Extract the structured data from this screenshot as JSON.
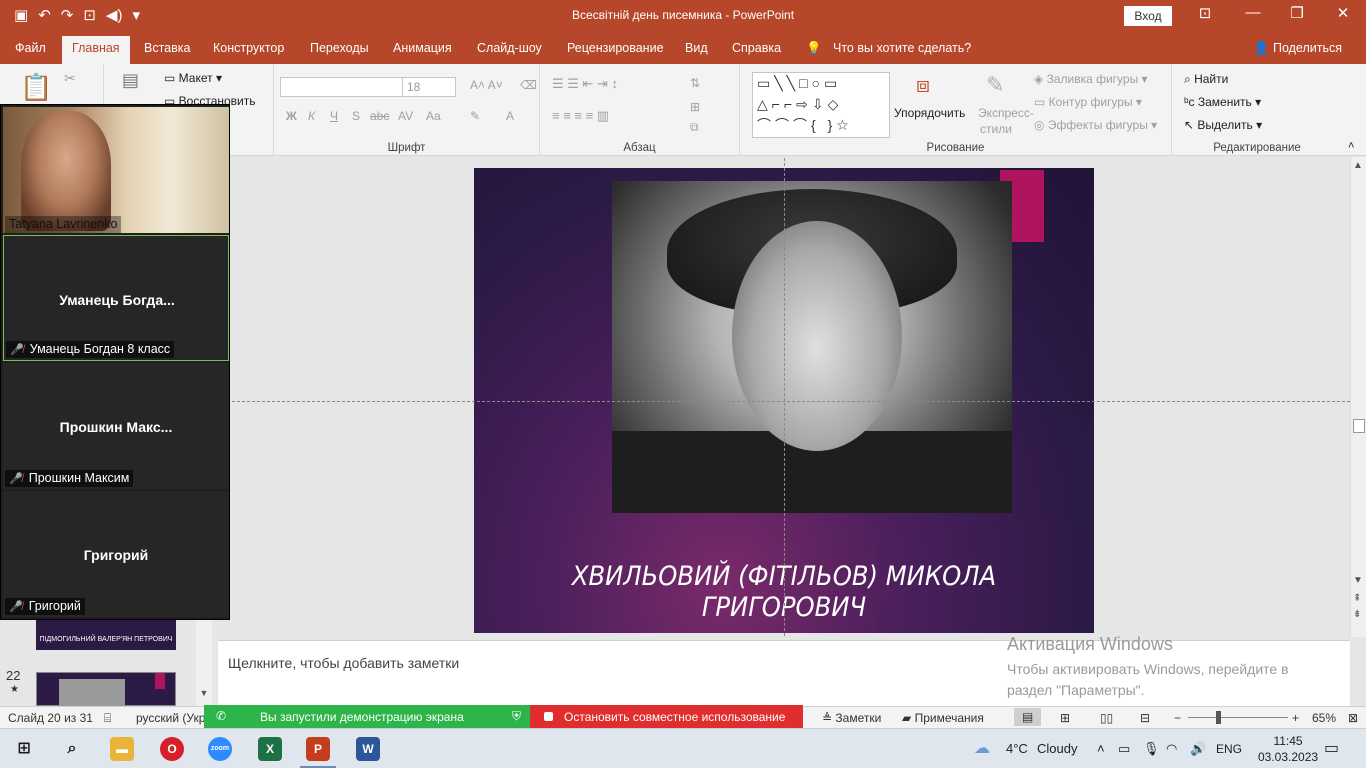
{
  "window": {
    "title": "Всесвітній день писемника  -  PowerPoint",
    "login_label": "Вход",
    "min": "—",
    "restore": "❐",
    "close": "✕",
    "ribbon_options": "⊡"
  },
  "tabs": [
    "Файл",
    "Главная",
    "Вставка",
    "Конструктор",
    "Переходы",
    "Анимация",
    "Слайд-шоу",
    "Рецензирование",
    "Вид",
    "Справка"
  ],
  "tell_me": "Что вы хотите сделать?",
  "share_label": "Поделиться",
  "ribbon": {
    "slides": {
      "layout": "Макет",
      "reset": "Восстановить"
    },
    "font": {
      "group": "Шрифт",
      "size": "18",
      "bold": "Ж",
      "italic": "К",
      "underline": "Ч",
      "shadow": "S",
      "strike": "abc",
      "spacing": "AV",
      "case": "Aa",
      "color": "A"
    },
    "paragraph": {
      "group": "Абзац"
    },
    "drawing": {
      "group": "Рисование",
      "arrange": "Упорядочить",
      "quick_styles_1": "Экспресс-",
      "quick_styles_2": "стили",
      "fill": "Заливка фигуры",
      "outline": "Контур фигуры",
      "effects": "Эффекты фигуры"
    },
    "editing": {
      "group": "Редактирование",
      "find": "Найти",
      "replace": "Заменить",
      "select": "Выделить"
    }
  },
  "slide": {
    "caption": "ХВИЛЬОВИЙ (ФІТІЛЬОВ) МИКОЛА ГРИГОРОВИЧ"
  },
  "notes_placeholder": "Щелкните, чтобы добавить заметки",
  "activation": {
    "line1": "Активация Windows",
    "line2": "Чтобы активировать Windows, перейдите в",
    "line3": "раздел \"Параметры\"."
  },
  "thumbnails": [
    {
      "number": "",
      "caption": "ПІДМОГИЛЬНИЙ ВАЛЕР'ЯН ПЕТРОВИЧ"
    },
    {
      "number": "22",
      "star": "★",
      "caption": ""
    }
  ],
  "zoom_participants": [
    {
      "display": "",
      "label": "Tatyana Lavrinenko",
      "video": true
    },
    {
      "display": "Уманець  Богда...",
      "label": "Уманець Богдан 8 класс",
      "video": false
    },
    {
      "display": "Прошкин  Макс...",
      "label": "Прошкин Максим",
      "video": false
    },
    {
      "display": "Григорий",
      "label": "Григорий",
      "video": false
    }
  ],
  "statusbar": {
    "slide_count": "Слайд 20 из 31",
    "language": "русский (Укр",
    "sharing": "Вы запустили демонстрацию экрана",
    "stop_sharing": "Остановить совместное использование",
    "notes": "Заметки",
    "comments": "Примечания",
    "zoom": "65%"
  },
  "taskbar": {
    "weather_temp": "4°C",
    "weather_text": "Cloudy",
    "lang": "ENG",
    "time": "11:45",
    "date": "03.03.2023",
    "zoom_app": "zoom"
  }
}
